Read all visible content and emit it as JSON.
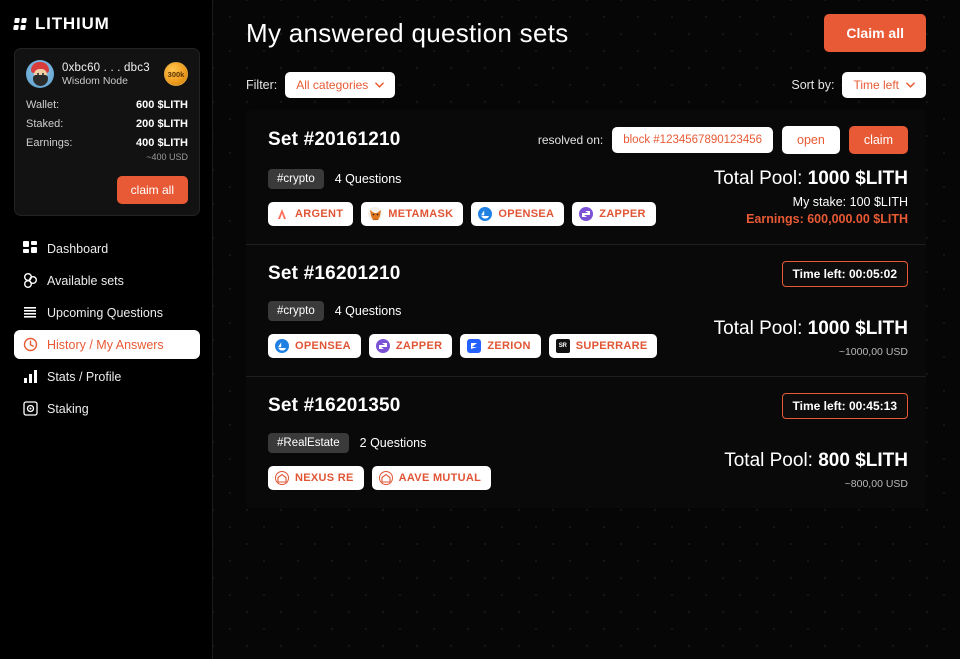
{
  "brand": {
    "name": "LITHIUM",
    "logo_icon": "dot-grid-icon"
  },
  "sidebar": {
    "wallet": {
      "address": "0xbc60 . . . dbc3",
      "role": "Wisdom Node",
      "badge": "300k",
      "stats": [
        {
          "label": "Wallet:",
          "value": "600 $LITH"
        },
        {
          "label": "Staked:",
          "value": "200 $LITH"
        },
        {
          "label": "Earnings:",
          "value": "400 $LITH",
          "sub": "~400 USD"
        }
      ],
      "claim_label": "claim all"
    },
    "nav": [
      {
        "label": "Dashboard",
        "icon": "dashboard-icon",
        "active": false
      },
      {
        "label": "Available sets",
        "icon": "cubes-icon",
        "active": false
      },
      {
        "label": "Upcoming Questions",
        "icon": "stack-icon",
        "active": false
      },
      {
        "label": "History / My Answers",
        "icon": "clock-icon",
        "active": true
      },
      {
        "label": "Stats / Profile",
        "icon": "bar-chart-icon",
        "active": false
      },
      {
        "label": "Staking",
        "icon": "coin-icon",
        "active": false
      }
    ]
  },
  "header": {
    "title": "My answered question sets",
    "claim_all_label": "Claim all"
  },
  "controls": {
    "filter_label": "Filter:",
    "filter_value": "All categories",
    "sort_label": "Sort by:",
    "sort_value": "Time left"
  },
  "colors": {
    "accent": "#e85a35",
    "background": "#060606",
    "card": "#090909",
    "tag": "#3a3a3a"
  },
  "sets": [
    {
      "title": "Set #20161210",
      "resolved_label": "resolved on:",
      "block": "block #1234567890123456",
      "open_label": "open",
      "claim_label": "claim",
      "category": "#crypto",
      "questions": "4 Questions",
      "brands": [
        {
          "name": "ARGENT",
          "icon": "argent-icon"
        },
        {
          "name": "METAMASK",
          "icon": "metamask-icon"
        },
        {
          "name": "OPENSEA",
          "icon": "opensea-icon"
        },
        {
          "name": "ZAPPER",
          "icon": "zapper-icon"
        }
      ],
      "pool_label": "Total Pool:",
      "pool_value": "1000 $LITH",
      "stake_line": "My stake: 100 $LITH",
      "earnings_label": "Earnings:",
      "earnings_value": "600,000.00 $LITH"
    },
    {
      "title": "Set #16201210",
      "time_left": "Time left: 00:05:02",
      "category": "#crypto",
      "questions": "4 Questions",
      "brands": [
        {
          "name": "OPENSEA",
          "icon": "opensea-icon"
        },
        {
          "name": "ZAPPER",
          "icon": "zapper-icon"
        },
        {
          "name": "ZERION",
          "icon": "zerion-icon"
        },
        {
          "name": "SUPERRARE",
          "icon": "superrare-icon"
        }
      ],
      "pool_label": "Total Pool:",
      "pool_value": "1000 $LITH",
      "usd": "~1000,00 USD"
    },
    {
      "title": "Set #16201350",
      "time_left": "Time left: 00:45:13",
      "category": "#RealEstate",
      "questions": "2 Questions",
      "brands": [
        {
          "name": "NEXUS RE",
          "icon": "nexus-re-icon"
        },
        {
          "name": "AAVE MUTUAL",
          "icon": "aave-mutual-icon"
        }
      ],
      "pool_label": "Total Pool:",
      "pool_value": "800 $LITH",
      "usd": "~800,00 USD"
    }
  ]
}
